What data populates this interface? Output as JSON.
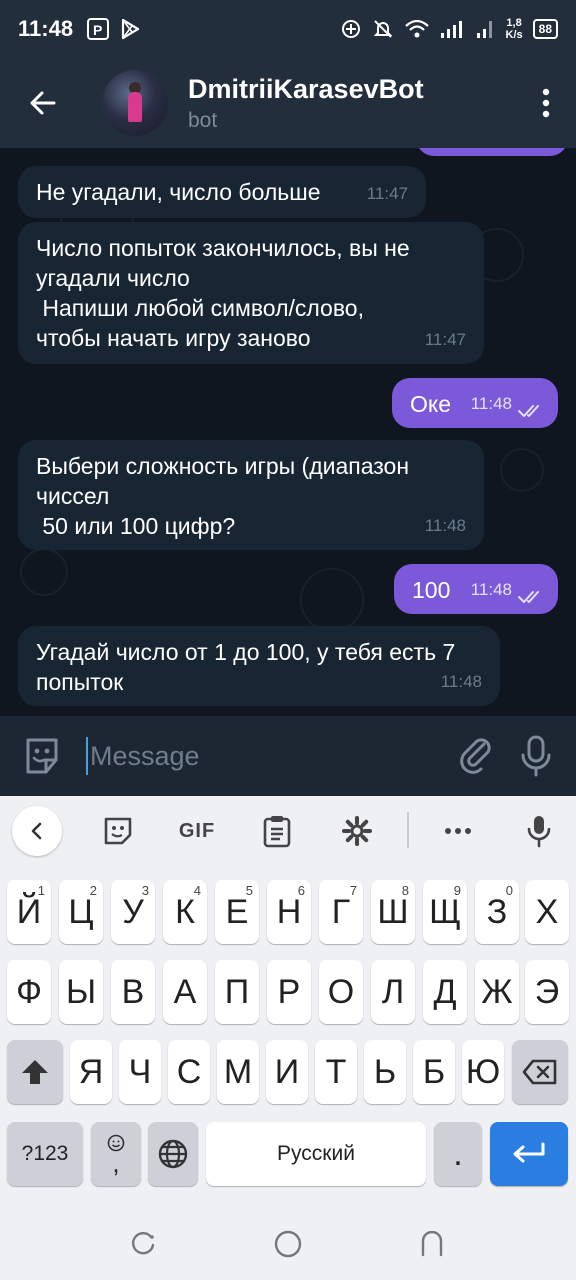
{
  "status_bar": {
    "time": "11:48",
    "speed_value": "1,8",
    "speed_unit": "K/s",
    "battery": "88"
  },
  "header": {
    "title": "DmitriiKarasevBot",
    "subtitle": "bot"
  },
  "messages": [
    {
      "direction": "in",
      "text": "Не угадали, число больше",
      "time": "11:47"
    },
    {
      "direction": "in",
      "text": "Число попыток закончилось, вы не угадали число\n Напиши любой символ/слово, чтобы начать игру заново",
      "time": "11:47"
    },
    {
      "direction": "out",
      "text": "Оке",
      "time": "11:48",
      "read": true
    },
    {
      "direction": "in",
      "text": "Выбери сложность игры (диапазон чиссел\n 50 или 100 цифр?",
      "time": "11:48"
    },
    {
      "direction": "out",
      "text": "100",
      "time": "11:48",
      "read": true
    },
    {
      "direction": "in",
      "text": "Угадай число от 1 до 100, у тебя есть 7 попыток",
      "time": "11:48"
    }
  ],
  "input": {
    "placeholder": "Message"
  },
  "keyboard": {
    "toolbar": {
      "gif_label": "GIF"
    },
    "row1": [
      {
        "label": "Й",
        "hint": "1"
      },
      {
        "label": "Ц",
        "hint": "2"
      },
      {
        "label": "У",
        "hint": "3"
      },
      {
        "label": "К",
        "hint": "4"
      },
      {
        "label": "Е",
        "hint": "5"
      },
      {
        "label": "Н",
        "hint": "6"
      },
      {
        "label": "Г",
        "hint": "7"
      },
      {
        "label": "Ш",
        "hint": "8"
      },
      {
        "label": "Щ",
        "hint": "9"
      },
      {
        "label": "З",
        "hint": "0"
      },
      {
        "label": "Х",
        "hint": ""
      }
    ],
    "row2": [
      "Ф",
      "Ы",
      "В",
      "А",
      "П",
      "Р",
      "О",
      "Л",
      "Д",
      "Ж",
      "Э"
    ],
    "row3": [
      "Я",
      "Ч",
      "С",
      "М",
      "И",
      "Т",
      "Ь",
      "Б",
      "Ю"
    ],
    "symbols_label": "?123",
    "comma_label": ",",
    "space_label": "Русский",
    "period_label": "."
  },
  "colors": {
    "outgoing_bubble": "#7b59d9",
    "incoming_bubble": "#182533",
    "accent": "#2a7de1"
  }
}
